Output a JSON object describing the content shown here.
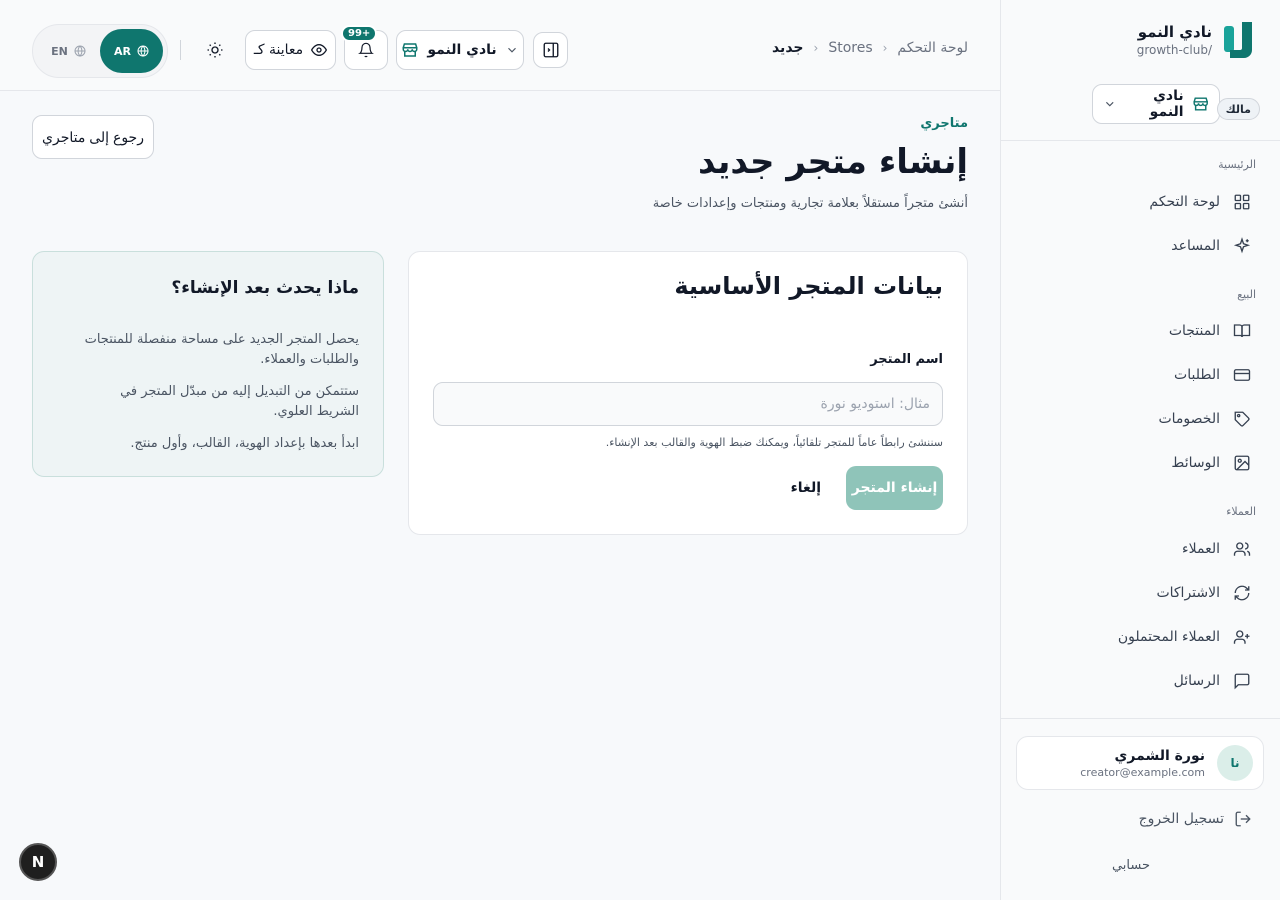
{
  "brand": {
    "name": "نادي النمو",
    "slug": "growth-club/"
  },
  "store_switcher": {
    "label": "نادي النمو",
    "role_badge": "مالك"
  },
  "sidebar": {
    "sections": {
      "home": "الرئيسية",
      "sales": "البيع",
      "customers": "العملاء"
    },
    "items": [
      {
        "label": "لوحة التحكم",
        "icon": "grid-icon"
      },
      {
        "label": "المساعد",
        "icon": "sparkles-icon"
      },
      {
        "label": "المنتجات",
        "icon": "book-open-icon"
      },
      {
        "label": "الطلبات",
        "icon": "credit-card-icon"
      },
      {
        "label": "الخصومات",
        "icon": "tag-icon"
      },
      {
        "label": "الوسائط",
        "icon": "image-icon"
      },
      {
        "label": "العملاء",
        "icon": "users-icon"
      },
      {
        "label": "الاشتراكات",
        "icon": "refresh-icon"
      },
      {
        "label": "العملاء المحتملون",
        "icon": "user-plus-icon"
      },
      {
        "label": "الرسائل",
        "icon": "message-icon"
      }
    ]
  },
  "user": {
    "initials": "نا",
    "name": "نورة الشمري",
    "email": "creator@example.com"
  },
  "logout_label": "تسجيل الخروج",
  "account_label": "حسابي",
  "header": {
    "breadcrumbs": [
      "لوحة التحكم",
      "Stores",
      "جديد"
    ],
    "store_label": "نادي النمو",
    "notif_count": "+99",
    "preview_label": "معاينة كـ",
    "lang_ar": "AR",
    "lang_en": "EN"
  },
  "page": {
    "eyebrow": "متاجري",
    "title": "إنشاء متجر جديد",
    "subtitle": "أنشئ متجراً مستقلاً بعلامة تجارية ومنتجات وإعدادات خاصة",
    "back_label": "رجوع إلى متاجري"
  },
  "form": {
    "title": "بيانات المتجر الأساسية",
    "name_label": "اسم المتجر",
    "name_value": "",
    "name_placeholder": "مثال: استوديو نورة",
    "help": "سننشئ رابطاً عاماً للمتجر تلقائياً، ويمكنك ضبط الهوية والقالب بعد الإنشاء.",
    "submit_label": "إنشاء المتجر",
    "cancel_label": "إلغاء"
  },
  "info": {
    "title": "ماذا يحدث بعد الإنشاء؟",
    "points": [
      "يحصل المتجر الجديد على مساحة منفصلة للمنتجات والطلبات والعملاء.",
      "ستتمكن من التبديل إليه من مبدّل المتجر في الشريط العلوي.",
      "ابدأ بعدها بإعداد الهوية، القالب، وأول منتج."
    ]
  },
  "fab_label": "N",
  "colors": {
    "accent": "#0f766e",
    "accent_light": "#8fc4b9"
  }
}
